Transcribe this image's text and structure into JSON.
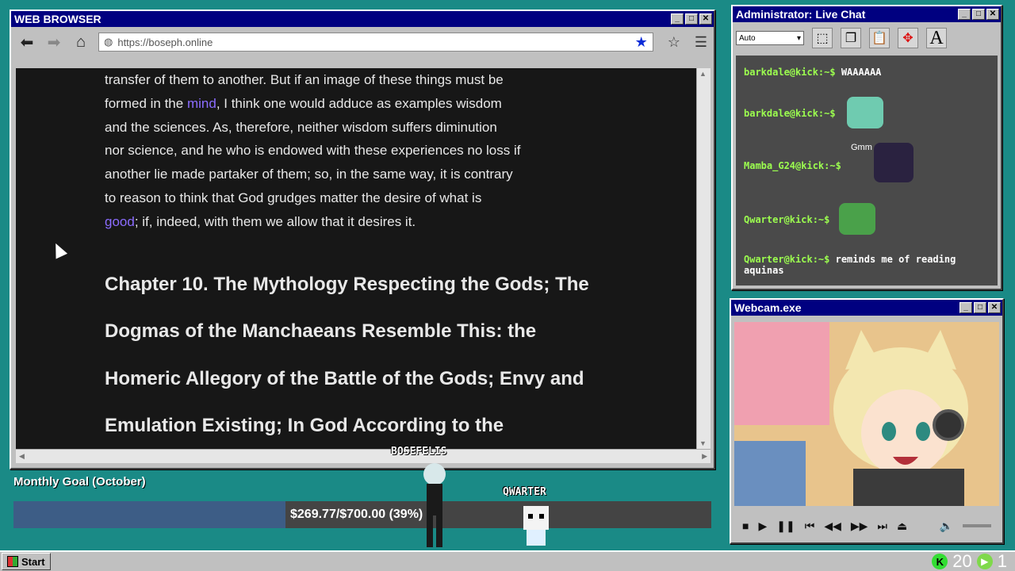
{
  "browser": {
    "title": "WEB BROWSER",
    "url": "https://boseph.online",
    "paragraph": {
      "line1": "transfer of them to another. But if an image of these things must be",
      "line2_pre": "formed in the ",
      "link_mind": "mind",
      "line2_post": ", I think one would adduce as examples wisdom",
      "line3": "and the sciences. As, therefore, neither wisdom suffers diminution",
      "line4": "nor science, and he who is endowed with these experiences no loss if",
      "line5": "another lie made partaker of them; so, in the same way, it is contrary",
      "line6": "to reason to think that God grudges matter the desire of what is",
      "link_good": "good",
      "line7_post": "; if, indeed, with them we allow that it desires it."
    },
    "chapter": {
      "line1": "Chapter 10. The Mythology Respecting the Gods; The",
      "line2": "Dogmas of the Manchaeans Resemble This: the",
      "line3": "Homeric Allegory of the Battle of the Gods; Envy and",
      "line4": "Emulation Existing; In God According to the"
    },
    "icons": {
      "back": "arrow-left-icon",
      "forward": "arrow-right-icon",
      "home": "home-icon",
      "globe": "globe-icon",
      "bookmark": "star-icon",
      "menu": "hamburger-icon"
    }
  },
  "chat": {
    "title": "Administrator: Live Chat",
    "select_value": "Auto",
    "messages": [
      {
        "user": "barkdale@kick:~$",
        "text": "WAAAAAA"
      },
      {
        "user": "barkdale@kick:~$",
        "text": ""
      },
      {
        "user": "Mamba_G24@kick:~$",
        "text": "Gmm"
      },
      {
        "user": "Qwarter@kick:~$",
        "text": ""
      },
      {
        "user": "Qwarter@kick:~$",
        "text": "reminds me of reading",
        "text2": "aquinas"
      }
    ]
  },
  "webcam": {
    "title": "Webcam.exe"
  },
  "goal": {
    "label": "Monthly Goal (October)",
    "text": "$269.77/$700.00 (39%)",
    "progress": 0.39
  },
  "players": {
    "p1": "BOSEFELIS",
    "p2": "QWARTER"
  },
  "taskbar": {
    "start": "Start",
    "kick_count": "20",
    "play_count": "1"
  },
  "colors": {
    "desktop": "#1a8a86",
    "titlebar": "#000080",
    "link": "#8b6cff",
    "chat_user": "#9cff4f",
    "goal_fill": "#3d5d86"
  }
}
